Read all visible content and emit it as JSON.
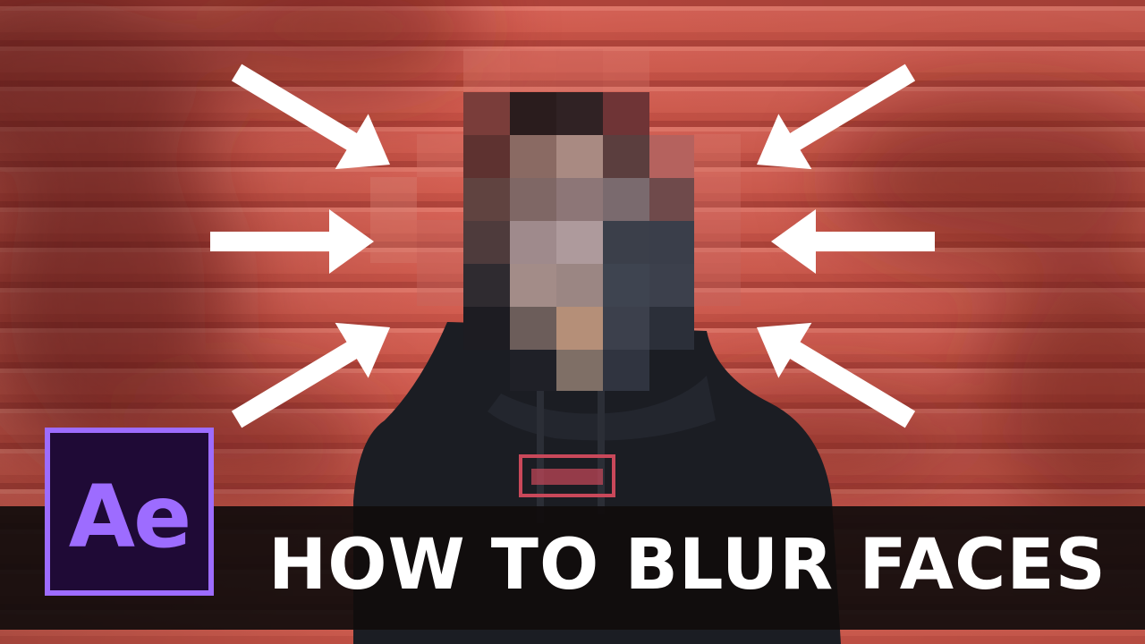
{
  "thumbnail": {
    "title": "HOW TO BLUR FACES",
    "logo_text": "Ae",
    "colors": {
      "wall": "#d0584c",
      "wall_shadow": "#9a2f2a",
      "hoodie": "#1a1c22",
      "logo_bg": "#1f0a36",
      "logo_accent": "#9d6cff",
      "banner": "#100c0c",
      "arrow": "#ffffff"
    },
    "icons": [
      "arrow-icon",
      "after-effects-logo"
    ]
  }
}
